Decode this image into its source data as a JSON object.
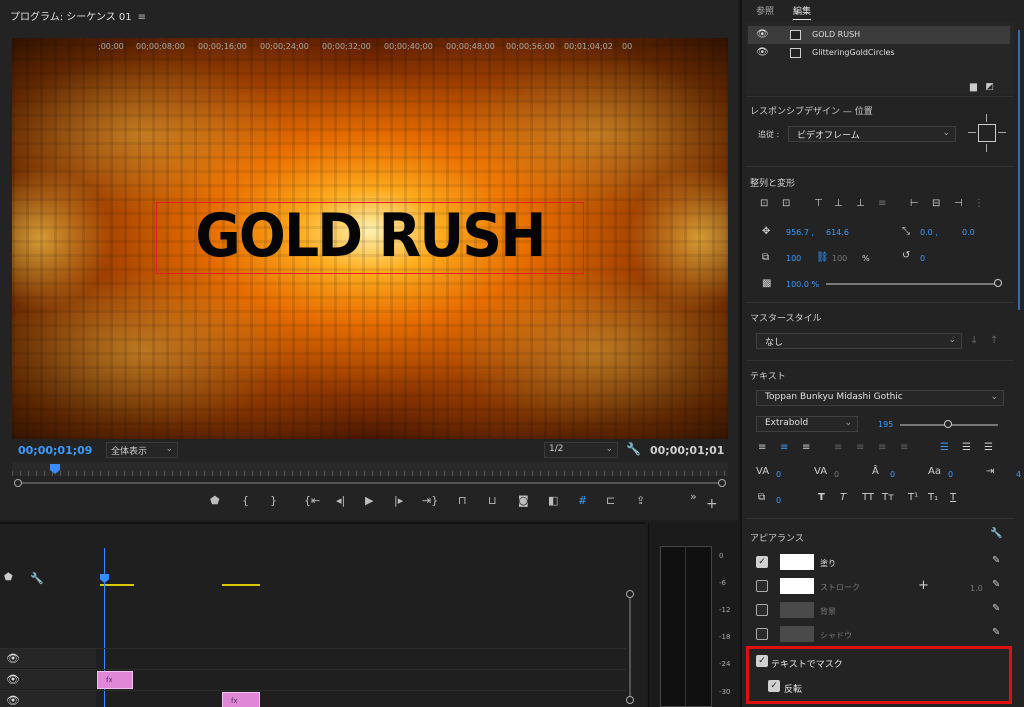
{
  "monitor": {
    "tab_title": "プログラム: シーケンス 01",
    "menu_icon": "hamburger-icon",
    "title_text": "GOLD RUSH",
    "timecode_current": "00;00;01;09",
    "zoom": "全体表示",
    "resolution": "1/2",
    "timecode_duration": "00;00;01;01"
  },
  "transport": {
    "buttons": [
      "marker-icon",
      "in-point-icon",
      "out-point-icon",
      "go-to-in-icon",
      "step-back-icon",
      "play-icon",
      "step-forward-icon",
      "go-to-out-icon",
      "lift-icon",
      "extract-icon",
      "export-frame-icon",
      "comparison-view-icon",
      "safe-margins-icon",
      "toggle-proxy-icon",
      "share-icon",
      "more-icon",
      "add-icon"
    ]
  },
  "timeline": {
    "ticks": [
      ";00;00",
      "00;00;08;00",
      "00;00;16;00",
      "00;00;24;00",
      "00;00;32;00",
      "00;00;40;00",
      "00;00;48;00",
      "00;00;56;00",
      "00;01;04;02",
      "00"
    ],
    "clip_label": "fx"
  },
  "meter": {
    "labels": [
      "0",
      "-6",
      "-12",
      "-18",
      "-24",
      "-30"
    ]
  },
  "panel": {
    "tabs": [
      "参照",
      "編集"
    ],
    "layers": [
      "GOLD RUSH",
      "GlitteringGoldCircles"
    ],
    "responsive": {
      "title": "レスポンシブデザイン — 位置",
      "follow_label": "追従 :",
      "follow_value": "ビデオフレーム"
    },
    "align": {
      "title": "整列と変形",
      "pos_x": "956.7 ,",
      "pos_y": "614.6",
      "anchor_x": "0.0 ,",
      "anchor_y": "0.0",
      "scale": "100",
      "scale_locked": "100",
      "percent": "%",
      "rotation": "0",
      "opacity": "100.0 %"
    },
    "master_style": {
      "title": "マスタースタイル",
      "value": "なし"
    },
    "text": {
      "title": "テキスト",
      "font": "Toppan Bunkyu Midashi Gothic",
      "weight": "Extrabold",
      "size": "195",
      "tracking": "0",
      "kerning": "0",
      "leading": "0",
      "baseline": "0",
      "tab_width": "4",
      "tsume": "0",
      "style_buttons": [
        "T",
        "T",
        "TT",
        "Tт",
        "T¹",
        "T₁",
        "T"
      ]
    },
    "appearance": {
      "title": "アピアランス",
      "fill_label": "塗り",
      "stroke_label": "ストローク",
      "stroke_width": "1.0",
      "background_label": "背景",
      "shadow_label": "シャドウ",
      "mask_label": "テキストでマスク",
      "invert_label": "反転"
    }
  }
}
